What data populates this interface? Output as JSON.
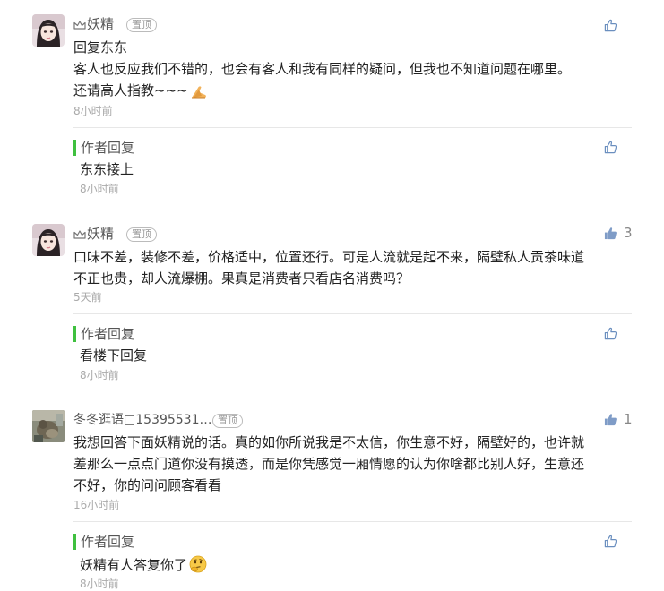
{
  "comments": [
    {
      "username": "妖精",
      "tag": "置顶",
      "lines": [
        "回复东东",
        "客人也反应我们不错的，也会有客人和我有同样的疑问，但我也不知道问题在哪里。",
        "还请高人指教~~~"
      ],
      "time": "8小时前",
      "reply_label": "作者回复",
      "reply_text": "东东接上",
      "reply_time": "8小时前"
    },
    {
      "username": "妖精",
      "tag": "置顶",
      "lines": [
        "口味不差，装修不差，价格适中，位置还行。可是人流就是起不来，隔壁私人贡茶味道",
        "不正也贵，却人流爆棚。果真是消费者只看店名消费吗？"
      ],
      "time": "5天前",
      "likes": "3",
      "reply_label": "作者回复",
      "reply_text": "看楼下回复",
      "reply_time": "8小时前"
    },
    {
      "username": "冬冬逛语□15395531…",
      "tag": "置顶",
      "lines": [
        "我想回答下面妖精说的话。真的如你所说我是不太信，你生意不好，隔壁好的，也许就",
        "差那么一点点门道你没有摸透，而是你凭感觉一厢情愿的认为你啥都比别人好，生意还",
        "不好，你的问问顾客看看"
      ],
      "time": "16小时前",
      "likes": "1",
      "reply_label": "作者回复",
      "reply_text": "妖精有人答复你了",
      "reply_time": "8小时前"
    }
  ],
  "icons": {
    "like": "thumbs-up-icon",
    "crown": "crown-icon",
    "pray": "praying-hands-emoji",
    "think": "thinking-face-emoji"
  },
  "colors": {
    "reply_bar": "#3fc03f",
    "like_outline": "#6b8fbf",
    "like_filled": "#7f9cc7"
  }
}
